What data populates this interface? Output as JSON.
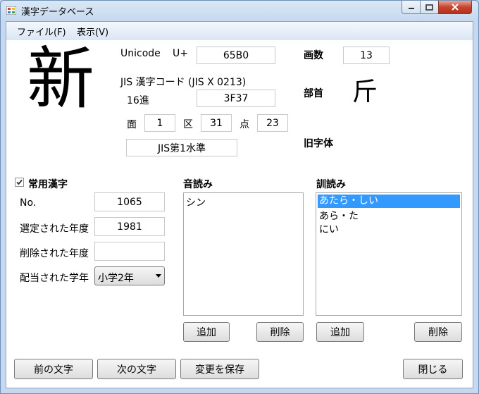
{
  "window": {
    "title": "漢字データベース"
  },
  "menu": [
    {
      "label": "ファイル(F)"
    },
    {
      "label": "表示(V)"
    }
  ],
  "kanji": {
    "char": "新"
  },
  "unicode": {
    "label": "Unicode",
    "prefix": "U+",
    "value": "65B0"
  },
  "jis": {
    "heading": "JIS 漢字コード (JIS X 0213)",
    "hex_label": "16進",
    "hex_value": "3F37",
    "men_label": "面",
    "men_value": "1",
    "ku_label": "区",
    "ku_value": "31",
    "ten_label": "点",
    "ten_value": "23",
    "level": "JIS第1水準"
  },
  "strokes": {
    "label": "画数",
    "value": "13"
  },
  "radical": {
    "label": "部首",
    "value": "斤"
  },
  "old_form": {
    "label": "旧字体"
  },
  "joyo": {
    "checkbox_label": "常用漢字",
    "checked": true,
    "no_label": "No.",
    "no_value": "1065",
    "selected_year_label": "選定された年度",
    "selected_year_value": "1981",
    "removed_year_label": "削除された年度",
    "removed_year_value": "",
    "grade_label": "配当された学年",
    "grade_value": "小学2年"
  },
  "on_reading": {
    "label": "音読み",
    "items": [
      "シン"
    ],
    "add": "追加",
    "delete": "削除"
  },
  "kun_reading": {
    "label": "訓読み",
    "items": [
      "あたら・しい",
      "あら・た",
      "にい"
    ],
    "selected_index": 0,
    "add": "追加",
    "delete": "削除"
  },
  "footer": {
    "prev": "前の文字",
    "next": "次の文字",
    "save": "変更を保存",
    "close": "閉じる"
  },
  "colors": {
    "selection": "#3399ff",
    "title_bg": "#c5d8ee",
    "close_red": "#c7442f"
  }
}
